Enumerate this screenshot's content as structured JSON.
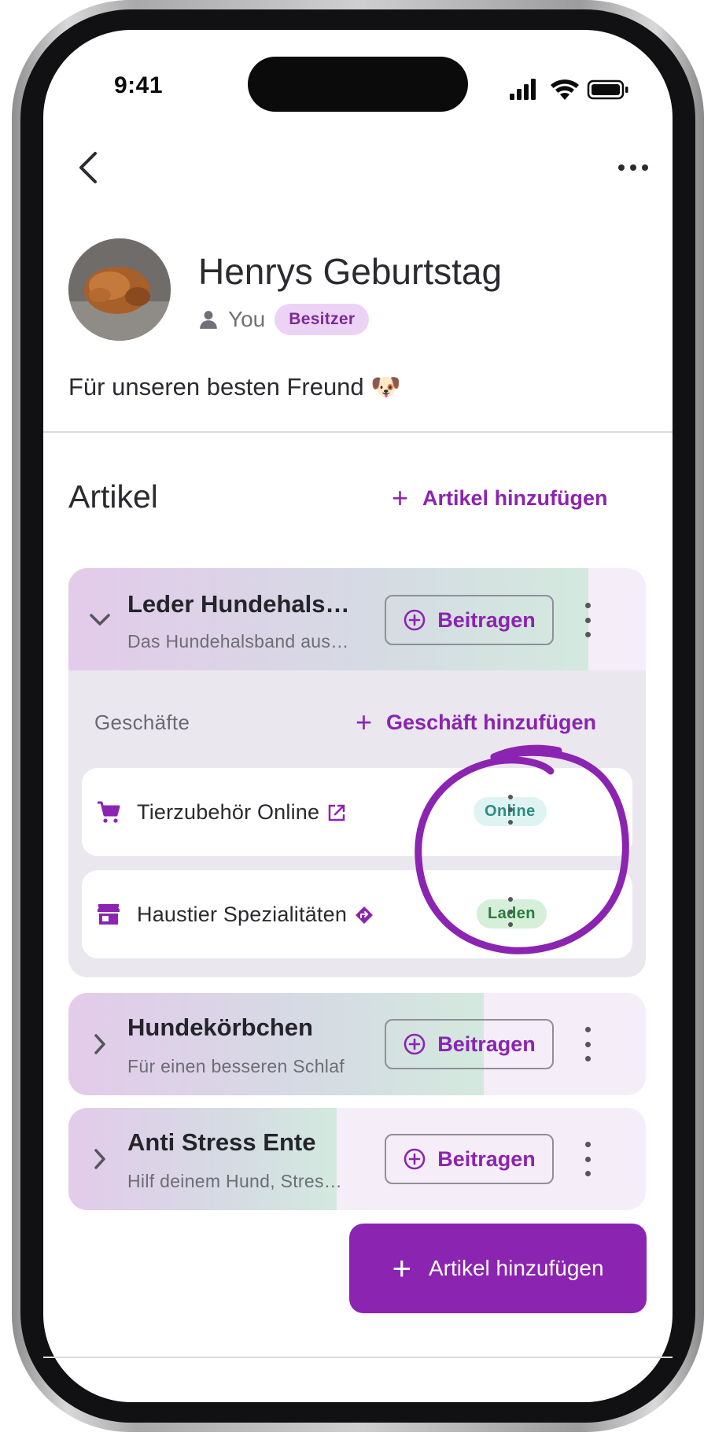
{
  "status_bar": {
    "time": "9:41"
  },
  "header": {
    "back_icon": "chevron-left-icon",
    "more_icon": "more-horizontal-icon"
  },
  "event": {
    "title": "Henrys Geburtstag",
    "owner_name": "You",
    "owner_badge": "Besitzer",
    "description": "Für unseren besten Freund 🐶"
  },
  "items_section": {
    "title": "Artikel",
    "add_link": "Artikel hinzufügen",
    "contribute_label": "Beitragen",
    "items": [
      {
        "name": "Leder Hundehals…",
        "subtitle": "Das Hundehalsband aus…",
        "expanded": true,
        "progress": 0.9
      },
      {
        "name": "Hundekörbchen",
        "subtitle": "Für einen besseren Schlaf",
        "expanded": false,
        "progress": 0.72
      },
      {
        "name": "Anti Stress Ente",
        "subtitle": "Hilf deinem Hund, Stres…",
        "expanded": false,
        "progress": 0.465
      }
    ]
  },
  "shops_section": {
    "label": "Geschäfte",
    "add_link": "Geschäft hinzufügen",
    "shops": [
      {
        "name": "Tierzubehör Online",
        "type_badge": "Online",
        "icon": "shopping-cart-icon",
        "link_icon": "external-link-icon"
      },
      {
        "name": "Haustier Spezialitäten",
        "type_badge": "Laden",
        "icon": "storefront-icon",
        "link_icon": "directions-icon"
      }
    ]
  },
  "fab": {
    "label": "Artikel hinzufügen"
  },
  "colors": {
    "accent": "#8b24b1",
    "badge_bg": "#ecd3f5",
    "online_bg": "#dff4f2",
    "store_bg": "#d5efd9"
  }
}
